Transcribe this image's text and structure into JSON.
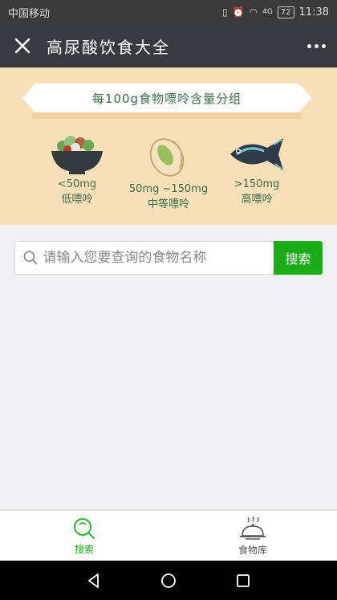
{
  "status_bar": {
    "carrier": "中国移动",
    "network": "4G",
    "battery": "72",
    "time": "11:38"
  },
  "header": {
    "title": "高尿酸饮食大全"
  },
  "banner": {
    "heading": "每100g食物嘌呤含量分组",
    "items": [
      {
        "range": "<50mg",
        "level": "低嘌呤",
        "icon": "salad-bowl-icon"
      },
      {
        "range": "50mg ~150mg",
        "level": "中等嘌呤",
        "icon": "pistachio-icon"
      },
      {
        "range": ">150mg",
        "level": "高嘌呤",
        "icon": "fish-icon"
      }
    ],
    "active_dot": 1
  },
  "search": {
    "placeholder": "请输入您要查询的食物名称",
    "button_label": "搜索"
  },
  "tabs": [
    {
      "label": "搜索",
      "icon": "search-icon",
      "active": true
    },
    {
      "label": "食物库",
      "icon": "food-cloche-icon",
      "active": false
    }
  ],
  "colors": {
    "accent": "#1aad19",
    "header_bg": "#393a3f",
    "banner_bg": "#f7e0b8"
  }
}
